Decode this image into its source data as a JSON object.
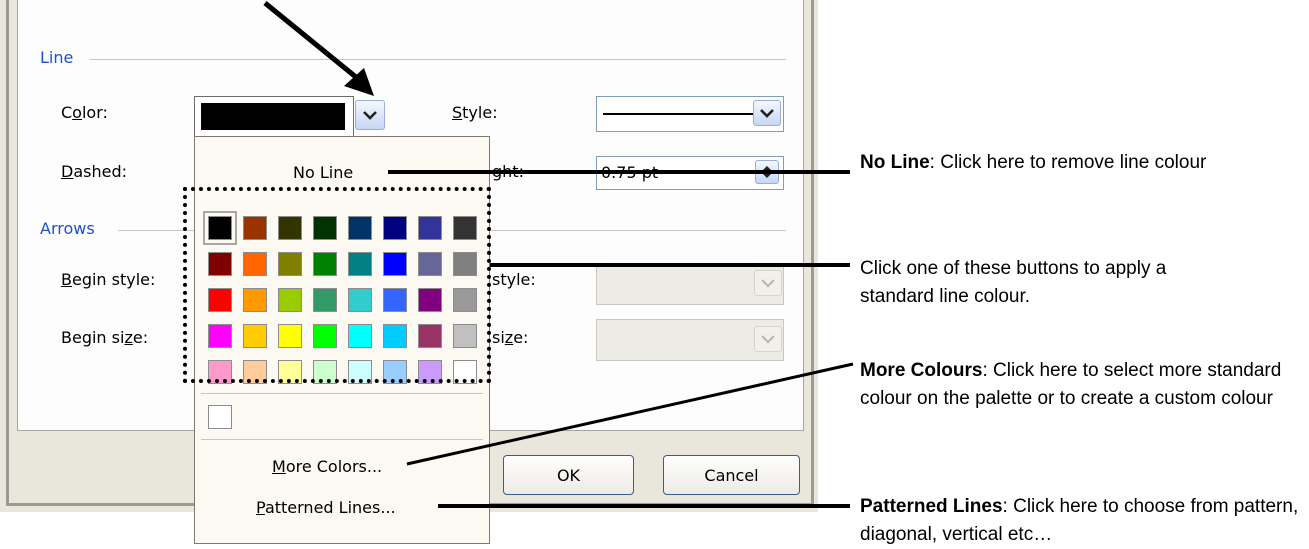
{
  "dialog": {
    "line_group": "Line",
    "arrows_group": "Arrows",
    "color_label": {
      "pre": "C",
      "u": "o",
      "post": "lor:"
    },
    "dashed_label": {
      "pre": "",
      "u": "D",
      "post": "ashed:"
    },
    "style_label": {
      "pre": "",
      "u": "S",
      "post": "tyle:"
    },
    "weight_label_partial": "ght:",
    "weight_value": "0.75 pt",
    "begin_style_label": {
      "pre": "",
      "u": "B",
      "post": "egin style:"
    },
    "begin_size_label": {
      "pre": "Begin si",
      "u": "z",
      "post": "e:"
    },
    "end_style_label_partial": "style:",
    "end_size_label_partial": {
      "pre": "si",
      "u": "z",
      "post": "e:"
    },
    "selected_color": "#000000",
    "ok_button": "OK",
    "cancel_button": "Cancel"
  },
  "palette": {
    "no_line": "No Line",
    "more_colors": {
      "pre": "",
      "u": "M",
      "post": "ore Colors..."
    },
    "patterned_lines": {
      "pre": "",
      "u": "P",
      "post": "atterned Lines..."
    },
    "rows": [
      [
        "#000000",
        "#993300",
        "#333300",
        "#003300",
        "#003366",
        "#000080",
        "#333399",
        "#333333"
      ],
      [
        "#800000",
        "#ff6600",
        "#808000",
        "#008000",
        "#008080",
        "#0000ff",
        "#666699",
        "#808080"
      ],
      [
        "#ff0000",
        "#ff9900",
        "#99cc00",
        "#339966",
        "#33cccc",
        "#3366ff",
        "#800080",
        "#999999"
      ],
      [
        "#ff00ff",
        "#ffcc00",
        "#ffff00",
        "#00ff00",
        "#00ffff",
        "#00ccff",
        "#993366",
        "#c0c0c0"
      ],
      [
        "#ff99cc",
        "#ffcc99",
        "#ffff99",
        "#ccffcc",
        "#ccffff",
        "#99ccff",
        "#cc99ff",
        "#ffffff"
      ]
    ],
    "custom_color": "#ffffff"
  },
  "callouts": {
    "no_line": {
      "bold": "No Line",
      "rest": ": Click here to remove line colour"
    },
    "standard": {
      "text": "Click one of these buttons to apply a standard line colour."
    },
    "more_colours": {
      "bold": "More Colours",
      "rest": ": Click here to select more standard colour on the palette or to create a custom colour"
    },
    "patterned": {
      "bold": "Patterned Lines",
      "rest": ": Click here to choose from pattern, diagonal, vertical etc…"
    }
  }
}
